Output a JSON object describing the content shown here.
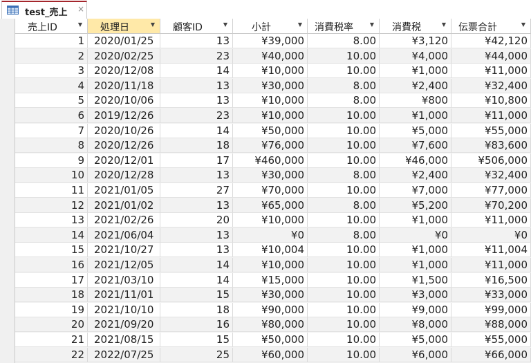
{
  "tab": {
    "title": "test_売上",
    "close": "×",
    "icon": "table-icon"
  },
  "columns": [
    {
      "label": "売上ID",
      "selected": false
    },
    {
      "label": "処理日",
      "selected": true
    },
    {
      "label": "顧客ID",
      "selected": false
    },
    {
      "label": "小計",
      "selected": false
    },
    {
      "label": "消費税率",
      "selected": false
    },
    {
      "label": "消費税",
      "selected": false
    },
    {
      "label": "伝票合計",
      "selected": false
    }
  ],
  "colors": {
    "header_selected": "#ffe9a8",
    "tab_accent": "#a4262c"
  },
  "rows": [
    [
      "1",
      "2020/01/25",
      "13",
      "¥39,000",
      "8.00",
      "¥3,120",
      "¥42,120"
    ],
    [
      "2",
      "2020/02/25",
      "23",
      "¥40,000",
      "10.00",
      "¥4,000",
      "¥44,000"
    ],
    [
      "3",
      "2020/12/08",
      "14",
      "¥10,000",
      "10.00",
      "¥1,000",
      "¥11,000"
    ],
    [
      "4",
      "2020/11/18",
      "13",
      "¥30,000",
      "8.00",
      "¥2,400",
      "¥32,400"
    ],
    [
      "5",
      "2020/10/06",
      "13",
      "¥10,000",
      "8.00",
      "¥800",
      "¥10,800"
    ],
    [
      "6",
      "2019/12/26",
      "23",
      "¥10,000",
      "10.00",
      "¥1,000",
      "¥11,000"
    ],
    [
      "7",
      "2020/10/26",
      "14",
      "¥50,000",
      "10.00",
      "¥5,000",
      "¥55,000"
    ],
    [
      "8",
      "2020/12/26",
      "18",
      "¥76,000",
      "10.00",
      "¥7,600",
      "¥83,600"
    ],
    [
      "9",
      "2020/12/01",
      "17",
      "¥460,000",
      "10.00",
      "¥46,000",
      "¥506,000"
    ],
    [
      "10",
      "2020/12/28",
      "13",
      "¥30,000",
      "8.00",
      "¥2,400",
      "¥32,400"
    ],
    [
      "11",
      "2021/01/05",
      "27",
      "¥70,000",
      "10.00",
      "¥7,000",
      "¥77,000"
    ],
    [
      "12",
      "2021/01/02",
      "13",
      "¥65,000",
      "8.00",
      "¥5,200",
      "¥70,200"
    ],
    [
      "13",
      "2021/02/26",
      "20",
      "¥10,000",
      "10.00",
      "¥1,000",
      "¥11,000"
    ],
    [
      "14",
      "2021/06/04",
      "13",
      "¥0",
      "8.00",
      "¥0",
      "¥0"
    ],
    [
      "15",
      "2021/10/27",
      "13",
      "¥10,004",
      "10.00",
      "¥1,000",
      "¥11,004"
    ],
    [
      "16",
      "2021/12/05",
      "14",
      "¥10,000",
      "10.00",
      "¥1,000",
      "¥11,000"
    ],
    [
      "17",
      "2021/03/10",
      "14",
      "¥15,000",
      "10.00",
      "¥1,500",
      "¥16,500"
    ],
    [
      "18",
      "2021/11/01",
      "15",
      "¥30,000",
      "10.00",
      "¥3,000",
      "¥33,000"
    ],
    [
      "19",
      "2021/10/10",
      "18",
      "¥90,000",
      "10.00",
      "¥9,000",
      "¥99,000"
    ],
    [
      "20",
      "2021/09/20",
      "16",
      "¥80,000",
      "10.00",
      "¥8,000",
      "¥88,000"
    ],
    [
      "21",
      "2021/08/15",
      "15",
      "¥50,000",
      "10.00",
      "¥5,000",
      "¥55,000"
    ],
    [
      "22",
      "2022/07/25",
      "25",
      "¥60,000",
      "10.00",
      "¥6,000",
      "¥66,000"
    ]
  ]
}
